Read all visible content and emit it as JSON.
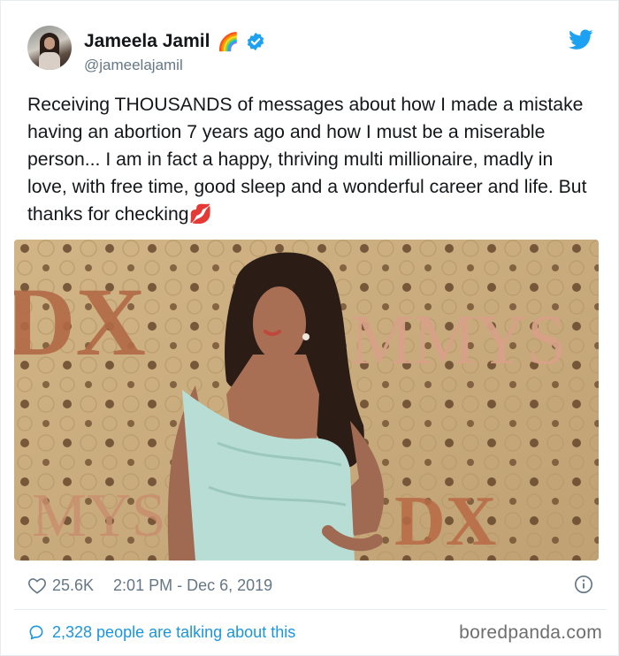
{
  "tweet": {
    "author_name": "Jameela Jamil",
    "author_emoji": "🌈",
    "handle": "@jameelajamil",
    "text": "Receiving THOUSANDS of messages about how I made a mistake having an abortion 7 years ago and how I must be a miserable person... I am in fact a happy, thriving multi millionaire, madly in love, with free time, good sleep and a wonderful career and life. But thanks for checking",
    "text_emoji": "💋",
    "likes": "25.6K",
    "timestamp": "2:01 PM - Dec 6, 2019",
    "discussion": "2,328 people are talking about this"
  },
  "photo": {
    "backdrop_text_left": "DX",
    "backdrop_text_right": "MMYS",
    "backdrop_text_bottom_left": "MYS",
    "backdrop_text_bottom_right": "DX"
  },
  "watermark": "boredpanda.com",
  "colors": {
    "verified_blue": "#1da1f2",
    "link_blue": "#1b95e0",
    "muted_gray": "#657786",
    "text": "#14171a",
    "backdrop_gold": "#c9ab7c",
    "dress_mint": "#b8ddd4"
  },
  "icons": {
    "verified": "verified-badge-icon",
    "brand": "twitter-bird-icon",
    "like": "heart-icon",
    "info": "info-icon",
    "comment": "comment-bubble-icon"
  }
}
